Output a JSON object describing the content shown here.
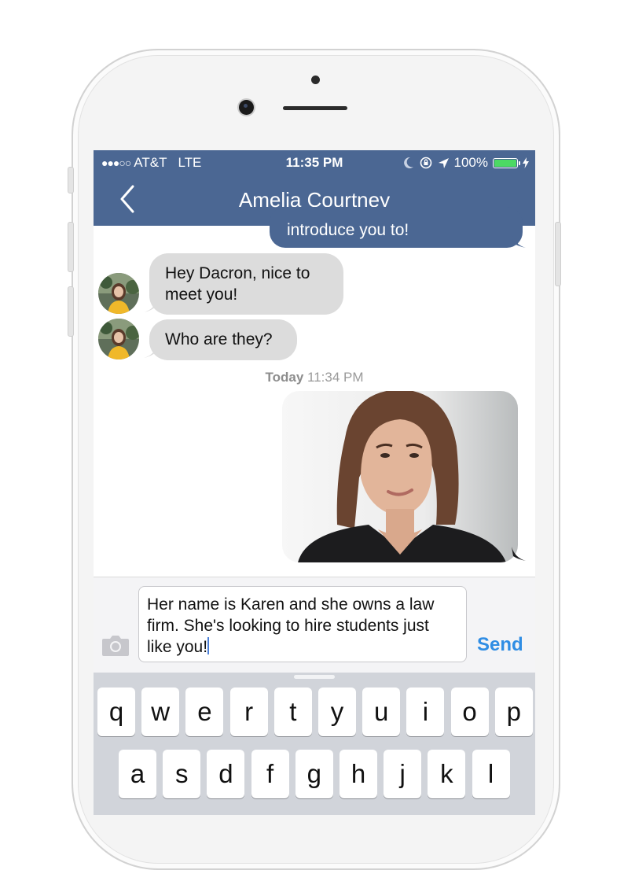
{
  "status_bar": {
    "signal_dots": "●●●○○",
    "carrier": "AT&T",
    "network": "LTE",
    "time": "11:35 PM",
    "battery_percent": "100%",
    "battery_level": 1.0
  },
  "nav": {
    "title": "Amelia Courtney"
  },
  "messages": {
    "partial_outgoing": "introduce you to!",
    "incoming_1": [
      "Hey Dacron, nice to",
      "meet you!"
    ],
    "incoming_2": "Who are they?",
    "timestamp_day": "Today",
    "timestamp_time": "11:34 PM"
  },
  "composer": {
    "text_lines": [
      "Her name is Karen and she owns a law",
      "firm. She's looking to hire students just",
      "like you!"
    ],
    "send_label": "Send"
  },
  "keyboard": {
    "row1": [
      "q",
      "w",
      "e",
      "r",
      "t",
      "y",
      "u",
      "i",
      "o",
      "p"
    ],
    "row2": [
      "a",
      "s",
      "d",
      "f",
      "g",
      "h",
      "j",
      "k",
      "l"
    ]
  },
  "colors": {
    "header": "#4b6793",
    "incoming_bubble": "#dcdcdc",
    "send": "#2f8de4",
    "battery_fill": "#4cd964"
  }
}
